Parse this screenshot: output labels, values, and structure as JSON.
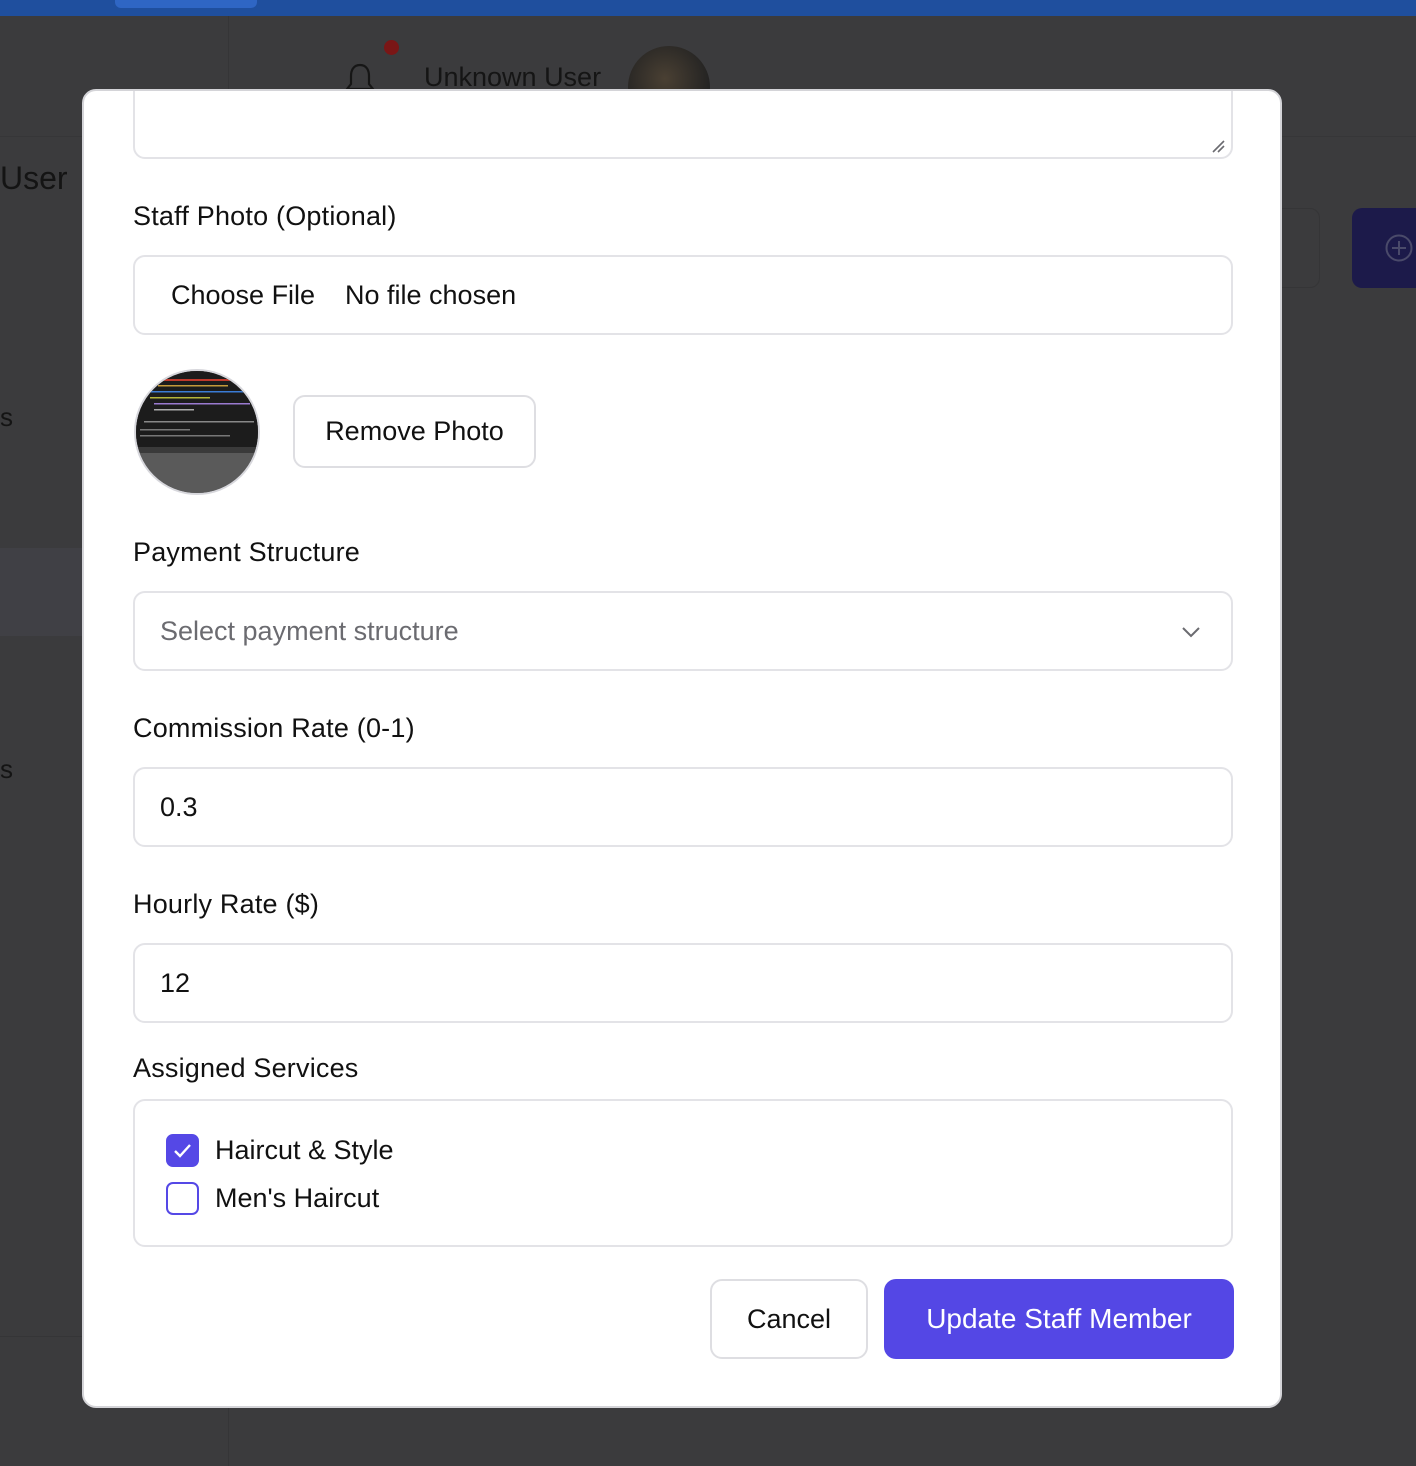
{
  "background": {
    "header": {
      "user_name": "Unknown User",
      "notification_indicator": "unread"
    },
    "page_title": "User",
    "sidebar_fragments": [
      "s",
      "s"
    ],
    "icons": {
      "bell": "bell-icon",
      "add": "plus-circle-icon"
    }
  },
  "modal": {
    "photo_section": {
      "label": "Staff Photo (Optional)",
      "file_button": "Choose File",
      "file_status": "No file chosen",
      "remove_button": "Remove Photo"
    },
    "payment_structure": {
      "label": "Payment Structure",
      "placeholder": "Select payment structure",
      "icon": "chevron-down-icon"
    },
    "commission_rate": {
      "label": "Commission Rate (0-1)",
      "value": "0.3"
    },
    "hourly_rate": {
      "label": "Hourly Rate ($)",
      "value": "12"
    },
    "assigned_services": {
      "label": "Assigned Services",
      "items": [
        {
          "label": "Haircut & Style",
          "checked": true
        },
        {
          "label": "Men's Haircut",
          "checked": false
        }
      ]
    },
    "actions": {
      "cancel_label": "Cancel",
      "submit_label": "Update Staff Member"
    }
  },
  "colors": {
    "accent": "#5447e5",
    "top_bar": "#1f4f9e",
    "overlay": "#3b3b3d"
  }
}
